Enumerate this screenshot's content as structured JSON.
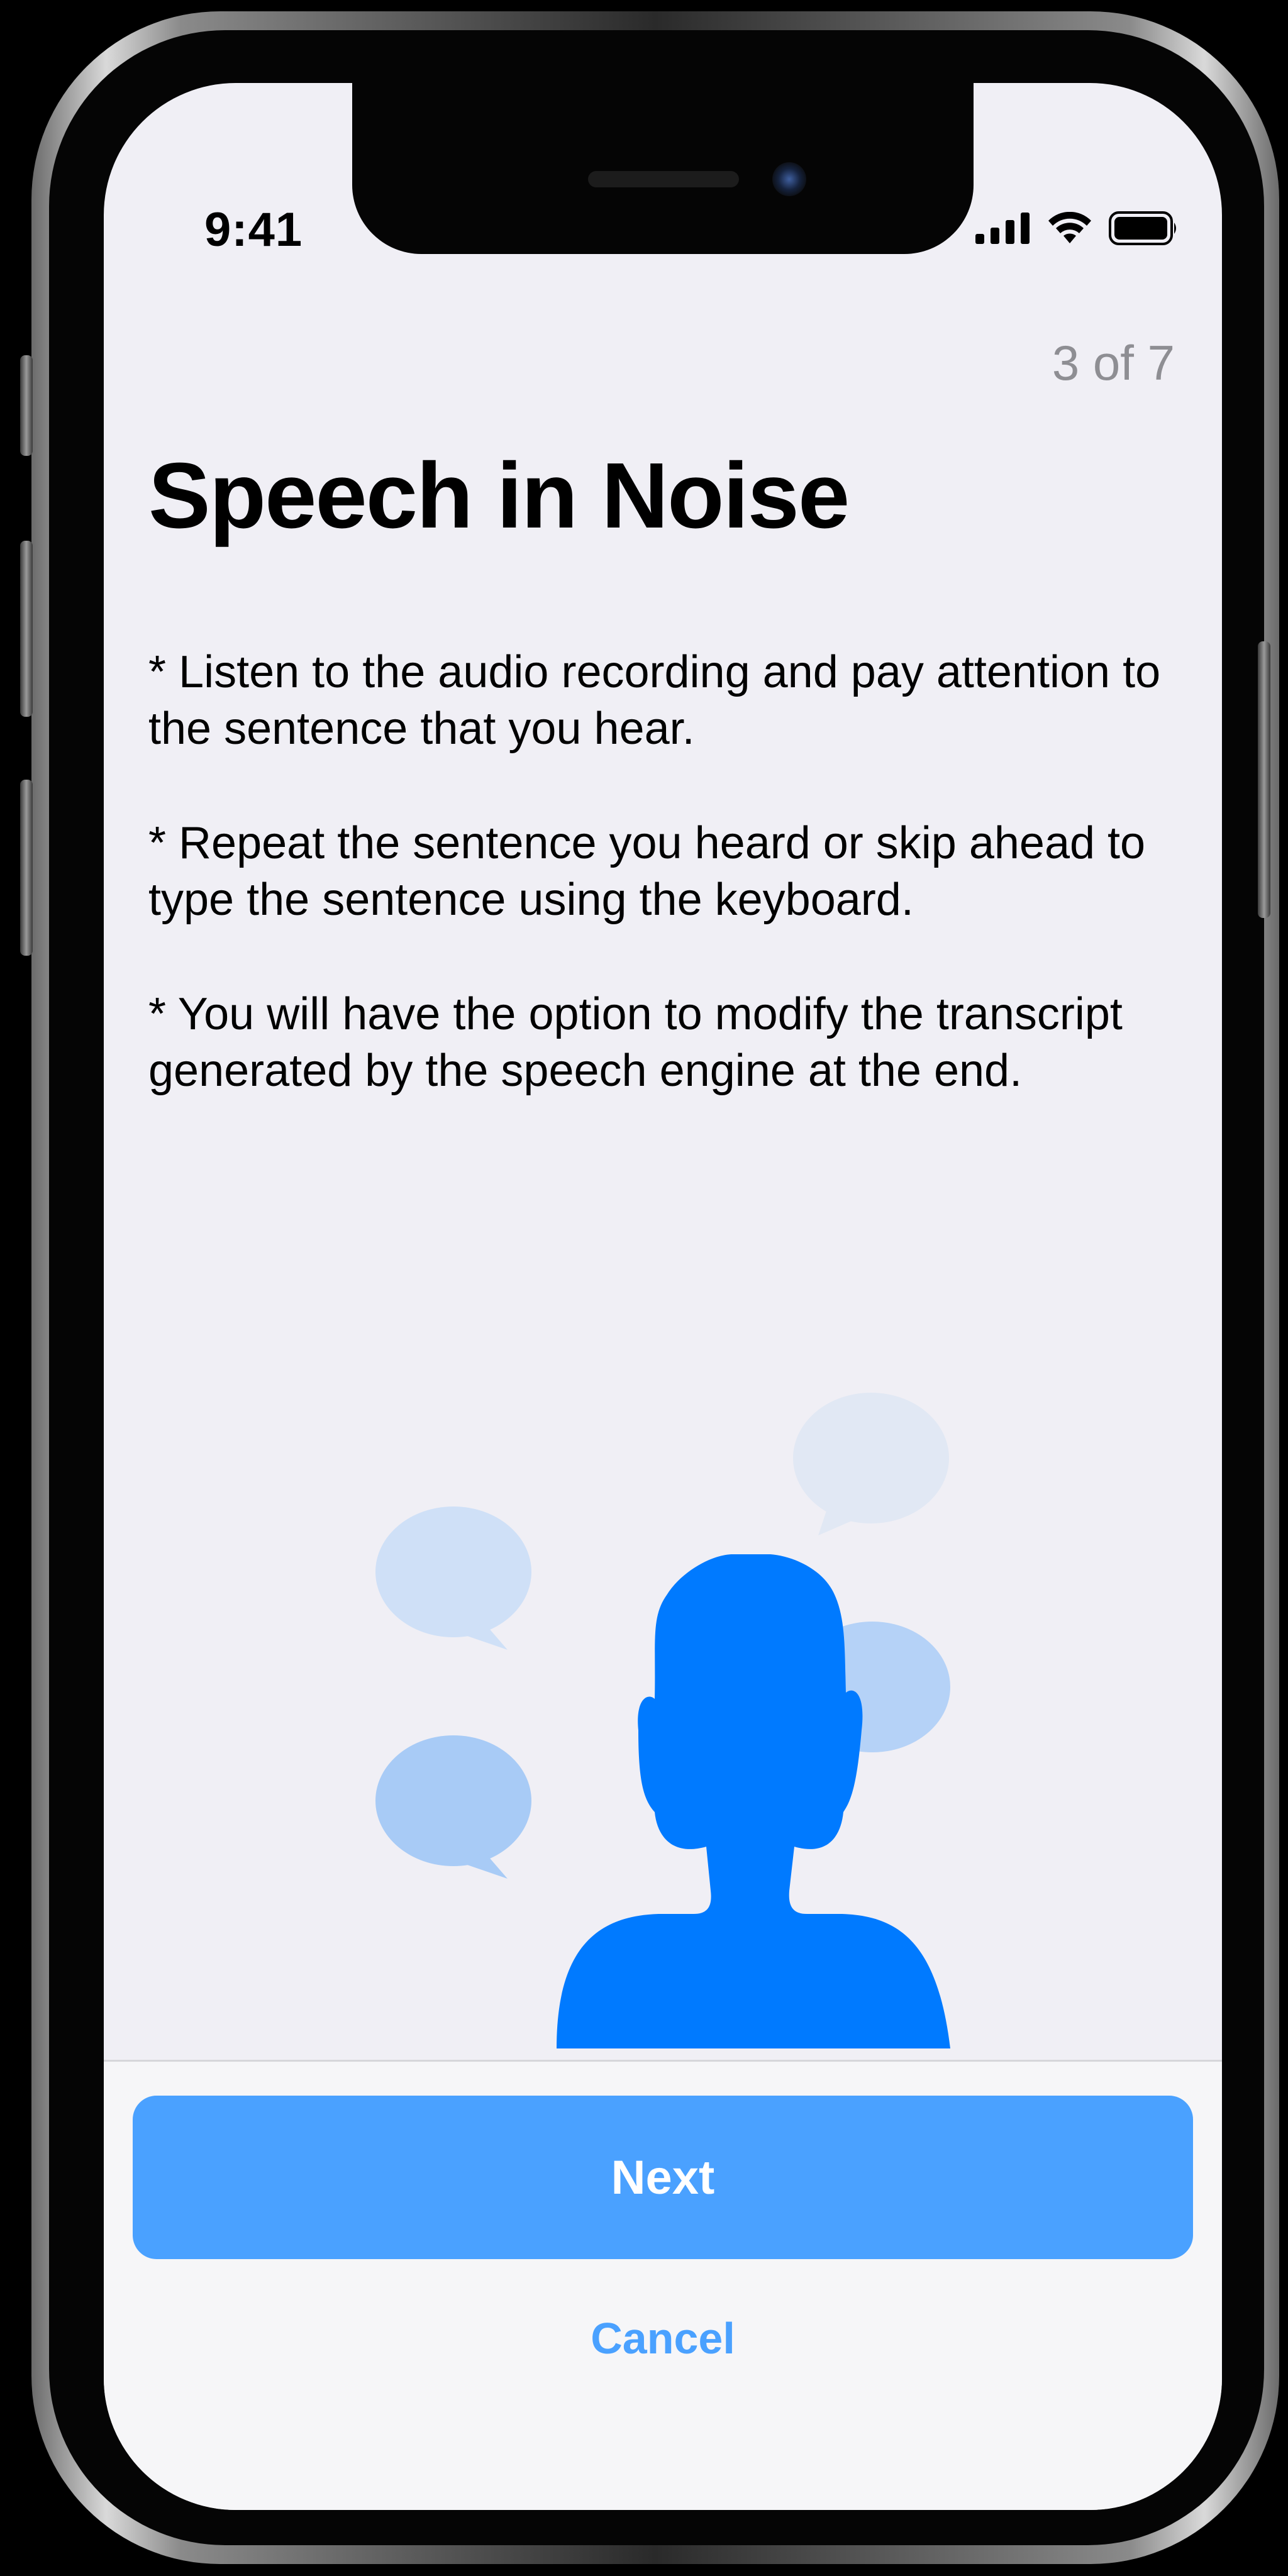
{
  "status_bar": {
    "time": "9:41",
    "icons": [
      "cellular-signal-icon",
      "wifi-icon",
      "battery-icon"
    ]
  },
  "header": {
    "step_counter": "3 of 7",
    "title": "Speech in Noise"
  },
  "instructions": [
    "* Listen to the audio recording and pay attention to the sentence that you hear.",
    "* Repeat the sentence you heard or skip ahead to type the sentence using the keyboard.",
    "* You will have the option to modify the transcript generated by the speech engine at the end."
  ],
  "illustration": {
    "icon": "person-with-speech-bubbles-icon",
    "colors": {
      "person": "#007aff",
      "bubble_light": "#e1e8f4",
      "bubble_mid": "#cfe0f7",
      "bubble_strong": "#a8cbf6"
    }
  },
  "actions": {
    "next_label": "Next",
    "cancel_label": "Cancel"
  },
  "colors": {
    "accent": "#4aa1ff",
    "background": "#f0eff5",
    "secondary_text": "#8e8e93"
  }
}
